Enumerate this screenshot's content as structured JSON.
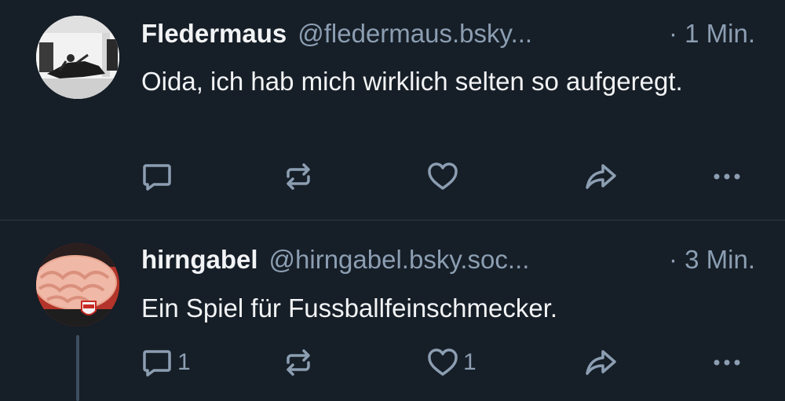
{
  "posts": [
    {
      "author_name": "Fledermaus",
      "author_handle": "@fledermaus.bsky...",
      "time": "· 1 Min.",
      "text": "Oida, ich hab mich wirklich selten so aufgeregt.",
      "reply_count": "",
      "like_count": ""
    },
    {
      "author_name": "hirngabel",
      "author_handle": "@hirngabel.bsky.soc...",
      "time": "· 3 Min.",
      "text": "Ein Spiel für Fussballfeinschmecker.",
      "reply_count": "1",
      "like_count": "1"
    }
  ],
  "icons": {
    "reply": "speech-bubble-icon",
    "repost": "repost-arrows-icon",
    "like": "heart-icon",
    "share": "share-arrow-icon",
    "more": "ellipsis-icon"
  },
  "colors": {
    "background": "#161e27",
    "text_primary": "#f1f3f5",
    "text_secondary": "#8c9eb2",
    "divider": "#2e3a48"
  }
}
